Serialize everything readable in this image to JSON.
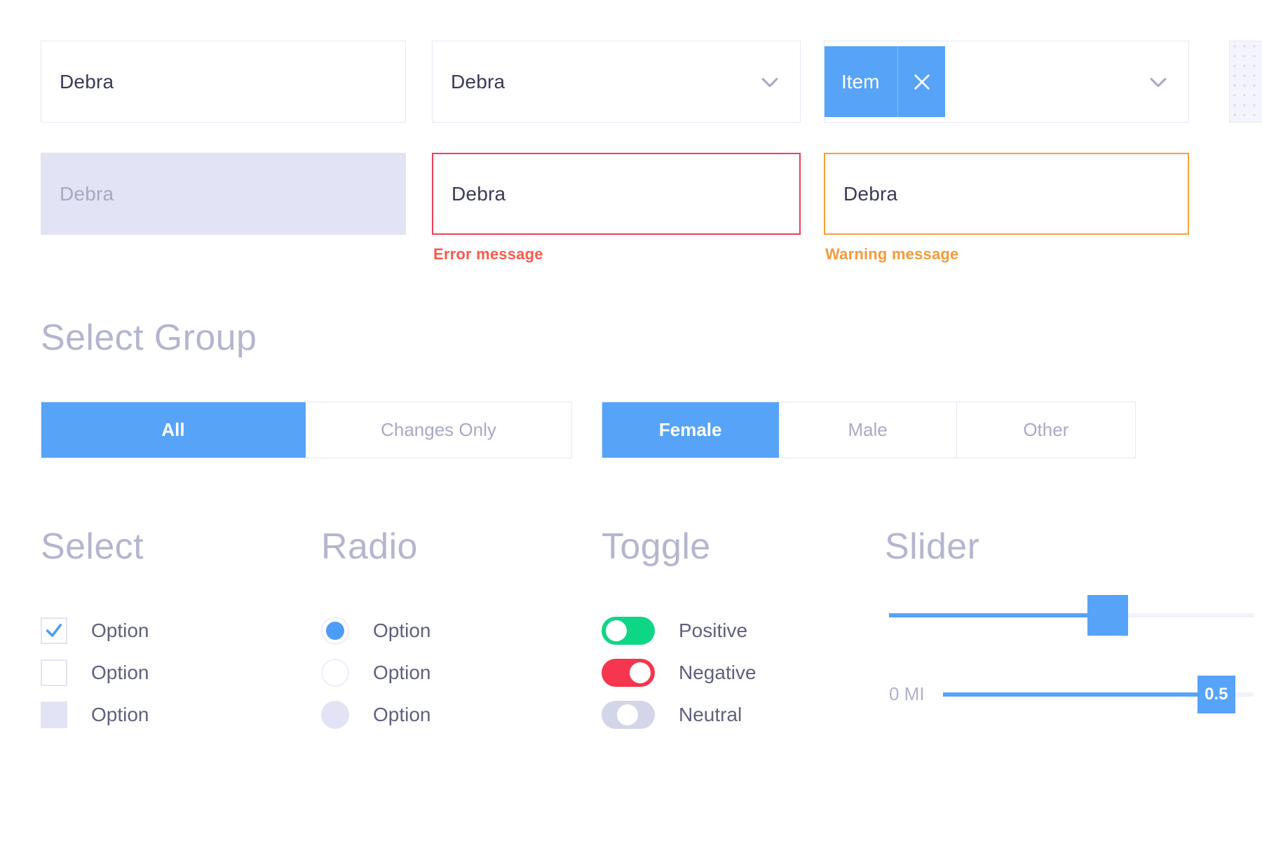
{
  "fields": {
    "text_input": {
      "value": "Debra",
      "placeholder": "Debra"
    },
    "select_input": {
      "value": "Debra"
    },
    "token_select": {
      "token_label": "Item",
      "remove_icon": "close-icon"
    },
    "locked_input": {
      "icon": "lock-icon"
    },
    "disabled_input": {
      "value": "Debra"
    },
    "error_input": {
      "value": "Debra",
      "message": "Error message"
    },
    "warning_input": {
      "value": "Debra",
      "message": "Warning message"
    }
  },
  "headings": {
    "select_group": "Select Group",
    "select": "Select",
    "radio": "Radio",
    "toggle": "Toggle",
    "slider": "Slider"
  },
  "segmented_groups": [
    {
      "name": "changes-filter",
      "options": [
        {
          "label": "All",
          "active": true
        },
        {
          "label": "Changes Only",
          "active": false
        }
      ]
    },
    {
      "name": "gender-filter",
      "options": [
        {
          "label": "Female",
          "active": true
        },
        {
          "label": "Male",
          "active": false
        },
        {
          "label": "Other",
          "active": false
        }
      ]
    }
  ],
  "checkboxes": [
    {
      "label": "Option",
      "state": "checked"
    },
    {
      "label": "Option",
      "state": "unchecked"
    },
    {
      "label": "Option",
      "state": "disabled"
    }
  ],
  "radios": [
    {
      "label": "Option",
      "state": "selected"
    },
    {
      "label": "Option",
      "state": "unselected"
    },
    {
      "label": "Option",
      "state": "disabled"
    }
  ],
  "toggles": [
    {
      "label": "Positive",
      "state": "on"
    },
    {
      "label": "Negative",
      "state": "negative"
    },
    {
      "label": "Neutral",
      "state": "neutral"
    }
  ],
  "sliders": [
    {
      "name": "plain-slider",
      "label": "",
      "value_label": "",
      "fill_percent": 60
    },
    {
      "name": "distance-slider",
      "label": "0 MI",
      "value_label": "0.5",
      "fill_percent": 88
    }
  ],
  "colors": {
    "accent_blue": "#57A3F8",
    "error_red": "#FA5A4B",
    "error_border": "#EE3F5B",
    "warning_orange": "#F79A3A",
    "warning_border": "#F5A33C",
    "toggle_green": "#0FD686",
    "toggle_red": "#F5364F",
    "toggle_neutral": "#D3D5E8",
    "disabled_fill": "#E2E3F4",
    "heading_gray": "#B4B6CE",
    "label_gray": "#60617E",
    "border_gray": "#E6E7F5"
  }
}
